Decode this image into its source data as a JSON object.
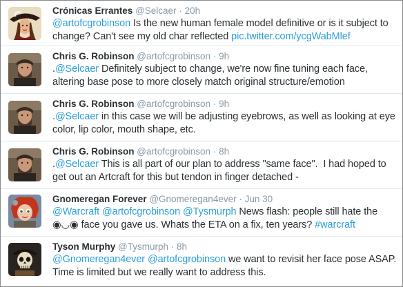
{
  "tweets": [
    {
      "avatar": "pirate-hat-woman-avatar",
      "name": "Crónicas Errantes",
      "handle": "@Selcaer",
      "dot": "·",
      "time": "20h",
      "parts": [
        {
          "t": "@artofcgrobinson",
          "link": true
        },
        {
          "t": " Is the new human female model definitive or is it subject to change? Can't see my old char reflected ",
          "link": false
        },
        {
          "t": "pic.twitter.com/ycgWabMlef",
          "link": true
        }
      ]
    },
    {
      "avatar": "bearded-man-avatar",
      "name": "Chris G. Robinson",
      "handle": "@artofcgrobinson",
      "dot": "·",
      "time": "9h",
      "parts": [
        {
          "t": ".",
          "link": false
        },
        {
          "t": "@Selcaer",
          "link": true
        },
        {
          "t": " Definitely subject to change, we're now fine tuning each face, altering base pose to more closely match original structure/emotion",
          "link": false
        }
      ]
    },
    {
      "avatar": "bearded-man-avatar",
      "name": "Chris G. Robinson",
      "handle": "@artofcgrobinson",
      "dot": "·",
      "time": "9h",
      "parts": [
        {
          "t": ".",
          "link": false
        },
        {
          "t": "@Selcaer",
          "link": true
        },
        {
          "t": " in this case we will be adjusting eyebrows, as well as looking at eye color, lip color, mouth shape, etc.",
          "link": false
        }
      ]
    },
    {
      "avatar": "bearded-man-avatar",
      "name": "Chris G. Robinson",
      "handle": "@artofcgrobinson",
      "dot": "·",
      "time": "8h",
      "parts": [
        {
          "t": ".",
          "link": false
        },
        {
          "t": "@Selcaer",
          "link": true
        },
        {
          "t": " This is all part of our plan to address \"same face\".  I had hoped to get out an Artcraft for this but tendon in finger detached -",
          "link": false
        }
      ]
    },
    {
      "avatar": "red-hair-gnome-avatar",
      "name": "Gnomeregan Forever",
      "handle": "@Gnomeregan4ever",
      "dot": "·",
      "time": "Jun 30",
      "parts": [
        {
          "t": "@Warcraft",
          "link": true
        },
        {
          "t": " ",
          "link": false
        },
        {
          "t": "@artofcgrobinson",
          "link": true
        },
        {
          "t": " ",
          "link": false
        },
        {
          "t": "@Tysmurph",
          "link": true
        },
        {
          "t": " News flash: people still hate the ◉◡◉ face you gave us. Whats the ETA on a fix, ten years? ",
          "link": false
        },
        {
          "t": "#warcraft",
          "link": true
        }
      ]
    },
    {
      "avatar": "skull-pirate-avatar",
      "name": "Tyson Murphy",
      "handle": "@Tysmurph",
      "dot": "·",
      "time": "8h",
      "parts": [
        {
          "t": "@Gnomeregan4ever",
          "link": true
        },
        {
          "t": " ",
          "link": false
        },
        {
          "t": "@artofcgrobinson",
          "link": true
        },
        {
          "t": " we want to revisit her face pose ASAP. Time is limited but we really want to address this.",
          "link": false
        }
      ]
    }
  ],
  "colors": {
    "link": "#2b9fd9",
    "muted": "#8899a6",
    "text": "#292f33",
    "divider": "#e1e8ed"
  }
}
